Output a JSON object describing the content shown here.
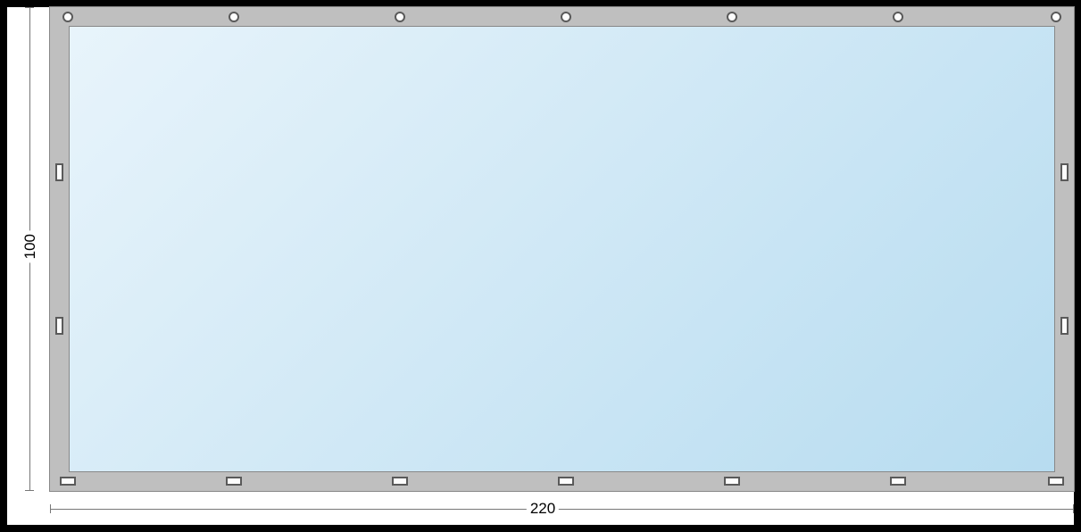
{
  "dimensions": {
    "width_label": "220",
    "height_label": "100"
  },
  "eyelets": {
    "top_count": 7,
    "bottom_count": 7,
    "left_count": 2,
    "right_count": 2,
    "top_shape": "circle",
    "bottom_shape": "rect-horizontal",
    "side_shape": "rect-vertical"
  },
  "colors": {
    "frame": "#bfbfbf",
    "panel_gradient_start": "#e8f4fb",
    "panel_gradient_end": "#b7dcf0",
    "outer": "#000000"
  }
}
